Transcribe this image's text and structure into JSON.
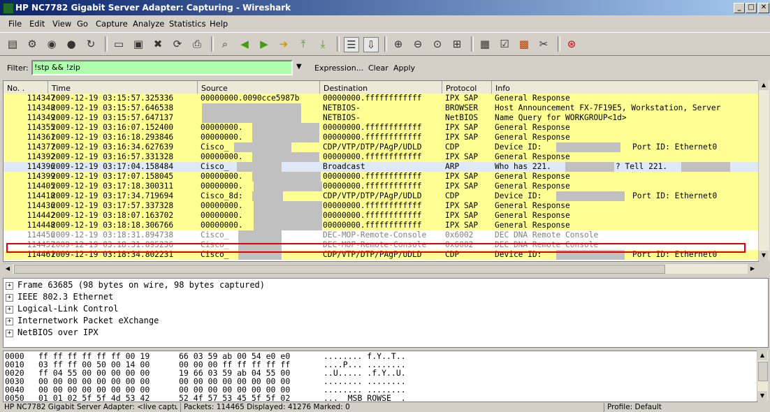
{
  "window": {
    "title": "HP NC7782 Gigabit Server Adapter: Capturing - Wireshark",
    "minimize": "_",
    "maximize": "□",
    "close": "✕"
  },
  "menu": [
    "File",
    "Edit",
    "View",
    "Go",
    "Capture",
    "Analyze",
    "Statistics",
    "Help"
  ],
  "filter": {
    "label": "Filter:",
    "value": "!stp && !zip",
    "expression": "Expression...",
    "clear": "Clear",
    "apply": "Apply",
    "valid_color": "#afffaf"
  },
  "columns": [
    "No. .",
    "Time",
    "Source",
    "Destination",
    "Protocol",
    "Info"
  ],
  "colors": {
    "ipx_yellow": "#ffff94",
    "selected": "#dfe8f6",
    "gray_text": "#808080",
    "highlight_border": "#e00000"
  },
  "packets": [
    {
      "no": "114347",
      "time": "2009-12-19 03:15:57.325336",
      "src": "00000000.0090cce5987b",
      "dst": "00000000.ffffffffffff",
      "proto": "IPX SAP",
      "info": "General Response"
    },
    {
      "no": "114348",
      "time": "2009-12-19 03:15:57.646538",
      "src": "",
      "dst": "NETBIOS-",
      "proto": "BROWSER",
      "info": "Host Announcement FX-7F19E5, Workstation, Server"
    },
    {
      "no": "114349",
      "time": "2009-12-19 03:15:57.647137",
      "src": "",
      "dst": "NETBIOS-",
      "proto": "NetBIOS",
      "info": "Name Query for WORKGROUP<1d>"
    },
    {
      "no": "114355",
      "time": "2009-12-19 03:16:07.152400",
      "src": "00000000.",
      "dst": "00000000.ffffffffffff",
      "proto": "IPX SAP",
      "info": "General Response"
    },
    {
      "no": "114361",
      "time": "2009-12-19 03:16:18.293846",
      "src": "00000000.",
      "dst": "00000000.ffffffffffff",
      "proto": "IPX SAP",
      "info": "General Response"
    },
    {
      "no": "114377",
      "time": "2009-12-19 03:16:34.627639",
      "src": "Cisco_",
      "dst": "CDP/VTP/DTP/PAgP/UDLD",
      "proto": "CDP",
      "info": "Device ID:",
      "info2": "Port ID: Ethernet0"
    },
    {
      "no": "114392",
      "time": "2009-12-19 03:16:57.331328",
      "src": "00000000.",
      "dst": "00000000.ffffffffffff",
      "proto": "IPX SAP",
      "info": "General Response"
    },
    {
      "no": "114396",
      "time": "2009-12-19 03:17:04.158484",
      "src": "Cisco_",
      "dst": "Broadcast",
      "proto": "ARP",
      "info": "Who has 221.",
      "info2": "?  Tell 221."
    },
    {
      "no": "114399",
      "time": "2009-12-19 03:17:07.158045",
      "src": "00000000.",
      "dst": "00000000.ffffffffffff",
      "proto": "IPX SAP",
      "info": "General Response"
    },
    {
      "no": "114405",
      "time": "2009-12-19 03:17:18.300311",
      "src": "00000000.",
      "dst": "00000000.ffffffffffff",
      "proto": "IPX SAP",
      "info": "General Response"
    },
    {
      "no": "114418",
      "time": "2009-12-19 03:17:34.719694",
      "src": "Cisco_8d:",
      "dst": "CDP/VTP/DTP/PAgP/UDLD",
      "proto": "CDP",
      "info": "Device ID:",
      "info2": "Port ID: Ethernet0"
    },
    {
      "no": "114436",
      "time": "2009-12-19 03:17:57.337328",
      "src": "00000000.",
      "dst": "00000000.ffffffffffff",
      "proto": "IPX SAP",
      "info": "General Response"
    },
    {
      "no": "114442",
      "time": "2009-12-19 03:18:07.163702",
      "src": "00000000.",
      "dst": "00000000.ffffffffffff",
      "proto": "IPX SAP",
      "info": "General Response"
    },
    {
      "no": "114448",
      "time": "2009-12-19 03:18:18.306766",
      "src": "00000000.",
      "dst": "00000000.ffffffffffff",
      "proto": "IPX SAP",
      "info": "General Response"
    },
    {
      "no": "114456",
      "time": "2009-12-19 03:18:31.894738",
      "src": "Cisco_",
      "dst": "DEC-MOP-Remote-Console",
      "proto": "0x6002",
      "info": "DEC DNA Remote Console"
    },
    {
      "no": "114457",
      "time": "2009-12-19 03:18:31.895236",
      "src": "Cisco_",
      "dst": "DEC-MOP-Remote-Console",
      "proto": "0x6002",
      "info": "DEC DNA Remote Console"
    },
    {
      "no": "114461",
      "time": "2009-12-19 03:18:34.802231",
      "src": "Cisco_",
      "dst": "CDP/VTP/DTP/PAgP/UDLD",
      "proto": "CDP",
      "info": "Device ID:",
      "info2": "Port ID: Ethernet0"
    }
  ],
  "details": [
    "Frame 63685 (98 bytes on wire, 98 bytes captured)",
    "IEEE 802.3 Ethernet",
    "Logical-Link Control",
    "Internetwork Packet eXchange",
    "NetBIOS over IPX"
  ],
  "hex": [
    {
      "off": "0000",
      "a": "ff ff ff ff ff ff 00 19",
      "b": "66 03 59 ab 00 54 e0 e0",
      "ascii": "........ f.Y..T.."
    },
    {
      "off": "0010",
      "a": "03 ff ff 00 50 00 14 00",
      "b": "00 00 00 ff ff ff ff ff",
      "ascii": "....P... ........"
    },
    {
      "off": "0020",
      "a": "ff 04 55 00 00 00 00 00",
      "b": "19 66 03 59 ab 04 55 00",
      "ascii": "..U..... .f.Y..U."
    },
    {
      "off": "0030",
      "a": "00 00 00 00 00 00 00 00",
      "b": "00 00 00 00 00 00 00 00",
      "ascii": "........ ........"
    },
    {
      "off": "0040",
      "a": "00 00 00 00 00 00 00 00",
      "b": "00 00 00 00 00 00 00 00",
      "ascii": "........ ........"
    },
    {
      "off": "0050",
      "a": "01 01 02 5f 5f 4d 53 42",
      "b": "52 4f 57 53 45 5f 5f 02",
      "ascii": "...__MSB ROWSE__."
    }
  ],
  "status": {
    "adapter": "HP NC7782 Gigabit Server Adapter: <live captur",
    "packets": "Packets: 114465 Displayed: 41276 Marked: 0",
    "profile": "Profile: Default"
  }
}
